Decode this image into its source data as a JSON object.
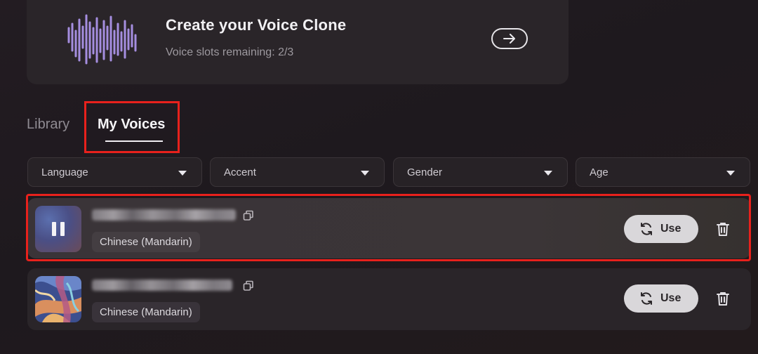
{
  "clone_card": {
    "title": "Create your Voice Clone",
    "subtitle": "Voice slots remaining: 2/3"
  },
  "tabs": [
    {
      "label": "Library",
      "active": false
    },
    {
      "label": "My Voices",
      "active": true
    }
  ],
  "filters": [
    {
      "label": "Language"
    },
    {
      "label": "Accent"
    },
    {
      "label": "Gender"
    },
    {
      "label": "Age"
    }
  ],
  "voices": [
    {
      "language": "Chinese (Mandarin)",
      "use_label": "Use",
      "playing": true
    },
    {
      "language": "Chinese (Mandarin)",
      "use_label": "Use",
      "playing": false
    }
  ],
  "colors": {
    "accent_purple": "#a58ee0",
    "highlight_red": "#e8211c",
    "use_button": "#d9d7da"
  },
  "icons": {
    "waveform": "waveform-icon",
    "arrow": "arrow-right-icon",
    "dropdown": "caret-down-icon",
    "pause": "pause-icon",
    "copy": "copy-icon",
    "sync": "refresh-icon",
    "trash": "trash-icon"
  }
}
